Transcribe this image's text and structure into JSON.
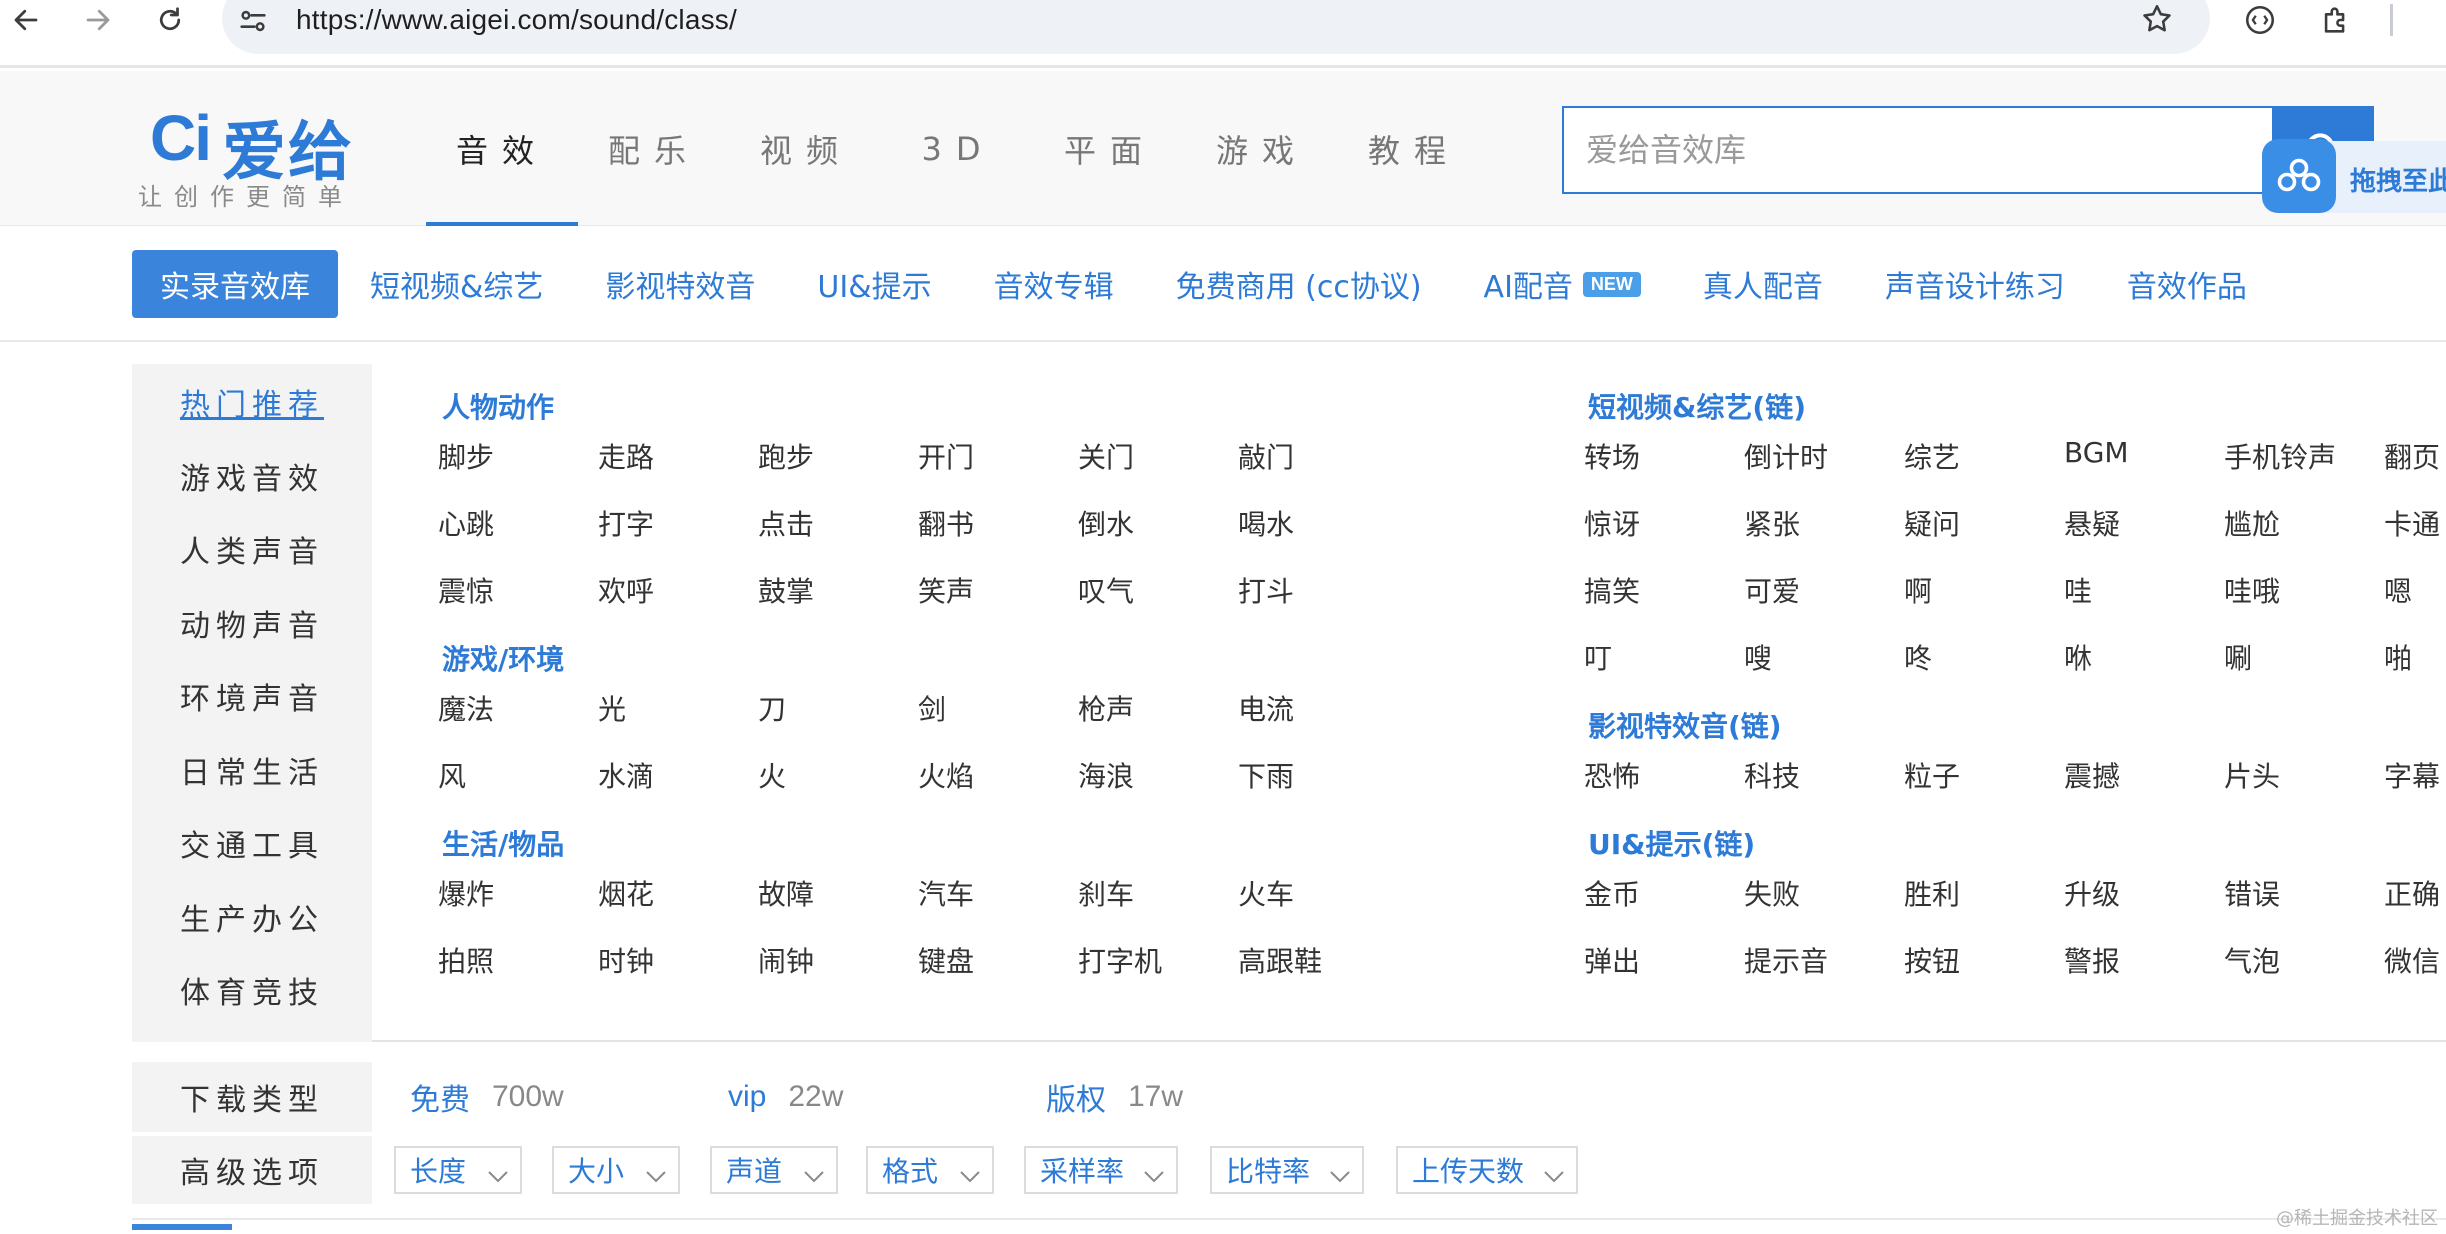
{
  "browser": {
    "url": "https://www.aigei.com/sound/class/"
  },
  "header": {
    "logo_ci": "Ci",
    "logo_text": "爱给",
    "slogan": "让创作更简单",
    "tabs": [
      "音效",
      "配乐",
      "视频",
      "3D",
      "平面",
      "游戏",
      "教程"
    ],
    "active_tab": "音效",
    "search_placeholder": "爱给音效库",
    "drag_label": "拖拽至此"
  },
  "subnav": {
    "items": [
      {
        "label": "实录音效库",
        "active": true
      },
      {
        "label": "短视频&综艺"
      },
      {
        "label": "影视特效音"
      },
      {
        "label": "UI&提示"
      },
      {
        "label": "音效专辑"
      },
      {
        "label": "免费商用 (cc协议)"
      },
      {
        "label": "AI配音",
        "badge": "NEW"
      },
      {
        "label": "真人配音"
      },
      {
        "label": "声音设计练习"
      },
      {
        "label": "音效作品"
      }
    ]
  },
  "sidebar": {
    "items": [
      "热门推荐",
      "游戏音效",
      "人类声音",
      "动物声音",
      "环境声音",
      "日常生活",
      "交通工具",
      "生产办公",
      "体育竞技"
    ],
    "active": "热门推荐"
  },
  "groups": {
    "left": [
      {
        "title": "人物动作",
        "rows": [
          [
            "脚步",
            "走路",
            "跑步",
            "开门",
            "关门",
            "敲门"
          ],
          [
            "心跳",
            "打字",
            "点击",
            "翻书",
            "倒水",
            "喝水"
          ],
          [
            "震惊",
            "欢呼",
            "鼓掌",
            "笑声",
            "叹气",
            "打斗"
          ]
        ]
      },
      {
        "title": "游戏/环境",
        "rows": [
          [
            "魔法",
            "光",
            "刀",
            "剑",
            "枪声",
            "电流"
          ],
          [
            "风",
            "水滴",
            "火",
            "火焰",
            "海浪",
            "下雨"
          ]
        ]
      },
      {
        "title": "生活/物品",
        "rows": [
          [
            "爆炸",
            "烟花",
            "故障",
            "汽车",
            "刹车",
            "火车"
          ],
          [
            "拍照",
            "时钟",
            "闹钟",
            "键盘",
            "打字机",
            "高跟鞋"
          ]
        ]
      }
    ],
    "right": [
      {
        "title": "短视频&综艺(链)",
        "rows": [
          [
            "转场",
            "倒计时",
            "综艺",
            "BGM",
            "手机铃声",
            "翻页"
          ],
          [
            "惊讶",
            "紧张",
            "疑问",
            "悬疑",
            "尴尬",
            "卡通"
          ],
          [
            "搞笑",
            "可爱",
            "啊",
            "哇",
            "哇哦",
            "嗯"
          ],
          [
            "叮",
            "嗖",
            "咚",
            "咻",
            "唰",
            "啪"
          ]
        ]
      },
      {
        "title": "影视特效音(链)",
        "rows": [
          [
            "恐怖",
            "科技",
            "粒子",
            "震撼",
            "片头",
            "字幕"
          ]
        ]
      },
      {
        "title": "UI&提示(链)",
        "rows": [
          [
            "金币",
            "失败",
            "胜利",
            "升级",
            "错误",
            "正确"
          ],
          [
            "弹出",
            "提示音",
            "按钮",
            "警报",
            "气泡",
            "微信"
          ]
        ]
      }
    ]
  },
  "filters": {
    "download_label": "下载类型",
    "download_options": [
      {
        "name": "免费",
        "count": "700w"
      },
      {
        "name": "vip",
        "count": "22w"
      },
      {
        "name": "版权",
        "count": "17w"
      }
    ],
    "advanced_label": "高级选项",
    "dropdowns": [
      "长度",
      "大小",
      "声道",
      "格式",
      "采样率",
      "比特率",
      "上传天数"
    ]
  },
  "watermark": "@稀土掘金技术社区",
  "colors": {
    "accent": "#2d7bd6",
    "sidebar_bg": "#f3f3f4"
  }
}
